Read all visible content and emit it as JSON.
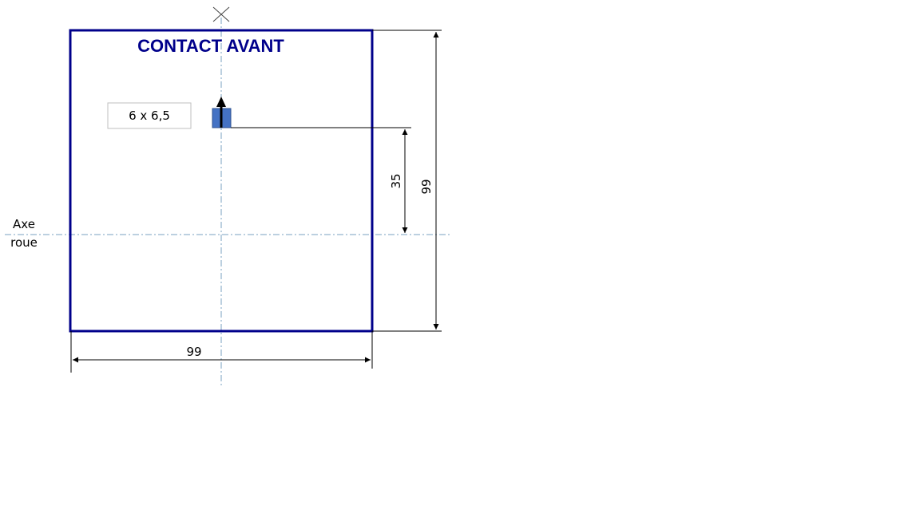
{
  "title": "CONTACT AVANT",
  "contact_size_label": "6 x 6,5",
  "axis_label_line1": "Axe",
  "axis_label_line2": "roue",
  "dimensions": {
    "width_bottom": "99",
    "height_right": "99",
    "contact_to_axis": "35"
  },
  "colors": {
    "frame": "#00008b",
    "title": "#00008b",
    "contact": "#4472c4",
    "centerline": "#7aa0c0",
    "dim_line": "#000000"
  }
}
